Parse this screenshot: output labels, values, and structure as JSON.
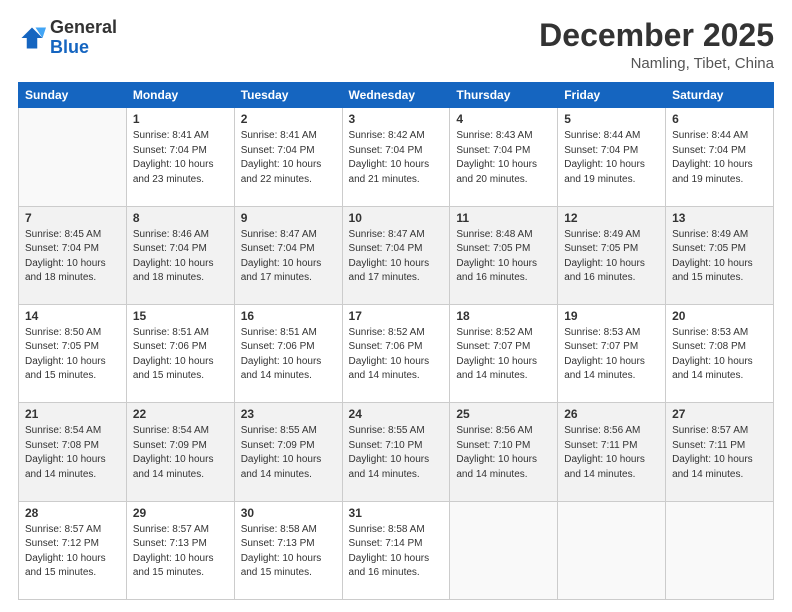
{
  "header": {
    "logo": {
      "general": "General",
      "blue": "Blue"
    },
    "title": "December 2025",
    "location": "Namling, Tibet, China"
  },
  "days_of_week": [
    "Sunday",
    "Monday",
    "Tuesday",
    "Wednesday",
    "Thursday",
    "Friday",
    "Saturday"
  ],
  "weeks": [
    [
      {
        "day": "",
        "empty": true
      },
      {
        "day": "1",
        "sunrise": "8:41 AM",
        "sunset": "7:04 PM",
        "daylight": "10 hours and 23 minutes."
      },
      {
        "day": "2",
        "sunrise": "8:41 AM",
        "sunset": "7:04 PM",
        "daylight": "10 hours and 22 minutes."
      },
      {
        "day": "3",
        "sunrise": "8:42 AM",
        "sunset": "7:04 PM",
        "daylight": "10 hours and 21 minutes."
      },
      {
        "day": "4",
        "sunrise": "8:43 AM",
        "sunset": "7:04 PM",
        "daylight": "10 hours and 20 minutes."
      },
      {
        "day": "5",
        "sunrise": "8:44 AM",
        "sunset": "7:04 PM",
        "daylight": "10 hours and 19 minutes."
      },
      {
        "day": "6",
        "sunrise": "8:44 AM",
        "sunset": "7:04 PM",
        "daylight": "10 hours and 19 minutes."
      }
    ],
    [
      {
        "day": "7",
        "sunrise": "8:45 AM",
        "sunset": "7:04 PM",
        "daylight": "10 hours and 18 minutes."
      },
      {
        "day": "8",
        "sunrise": "8:46 AM",
        "sunset": "7:04 PM",
        "daylight": "10 hours and 18 minutes."
      },
      {
        "day": "9",
        "sunrise": "8:47 AM",
        "sunset": "7:04 PM",
        "daylight": "10 hours and 17 minutes."
      },
      {
        "day": "10",
        "sunrise": "8:47 AM",
        "sunset": "7:04 PM",
        "daylight": "10 hours and 17 minutes."
      },
      {
        "day": "11",
        "sunrise": "8:48 AM",
        "sunset": "7:05 PM",
        "daylight": "10 hours and 16 minutes."
      },
      {
        "day": "12",
        "sunrise": "8:49 AM",
        "sunset": "7:05 PM",
        "daylight": "10 hours and 16 minutes."
      },
      {
        "day": "13",
        "sunrise": "8:49 AM",
        "sunset": "7:05 PM",
        "daylight": "10 hours and 15 minutes."
      }
    ],
    [
      {
        "day": "14",
        "sunrise": "8:50 AM",
        "sunset": "7:05 PM",
        "daylight": "10 hours and 15 minutes."
      },
      {
        "day": "15",
        "sunrise": "8:51 AM",
        "sunset": "7:06 PM",
        "daylight": "10 hours and 15 minutes."
      },
      {
        "day": "16",
        "sunrise": "8:51 AM",
        "sunset": "7:06 PM",
        "daylight": "10 hours and 14 minutes."
      },
      {
        "day": "17",
        "sunrise": "8:52 AM",
        "sunset": "7:06 PM",
        "daylight": "10 hours and 14 minutes."
      },
      {
        "day": "18",
        "sunrise": "8:52 AM",
        "sunset": "7:07 PM",
        "daylight": "10 hours and 14 minutes."
      },
      {
        "day": "19",
        "sunrise": "8:53 AM",
        "sunset": "7:07 PM",
        "daylight": "10 hours and 14 minutes."
      },
      {
        "day": "20",
        "sunrise": "8:53 AM",
        "sunset": "7:08 PM",
        "daylight": "10 hours and 14 minutes."
      }
    ],
    [
      {
        "day": "21",
        "sunrise": "8:54 AM",
        "sunset": "7:08 PM",
        "daylight": "10 hours and 14 minutes."
      },
      {
        "day": "22",
        "sunrise": "8:54 AM",
        "sunset": "7:09 PM",
        "daylight": "10 hours and 14 minutes."
      },
      {
        "day": "23",
        "sunrise": "8:55 AM",
        "sunset": "7:09 PM",
        "daylight": "10 hours and 14 minutes."
      },
      {
        "day": "24",
        "sunrise": "8:55 AM",
        "sunset": "7:10 PM",
        "daylight": "10 hours and 14 minutes."
      },
      {
        "day": "25",
        "sunrise": "8:56 AM",
        "sunset": "7:10 PM",
        "daylight": "10 hours and 14 minutes."
      },
      {
        "day": "26",
        "sunrise": "8:56 AM",
        "sunset": "7:11 PM",
        "daylight": "10 hours and 14 minutes."
      },
      {
        "day": "27",
        "sunrise": "8:57 AM",
        "sunset": "7:11 PM",
        "daylight": "10 hours and 14 minutes."
      }
    ],
    [
      {
        "day": "28",
        "sunrise": "8:57 AM",
        "sunset": "7:12 PM",
        "daylight": "10 hours and 15 minutes."
      },
      {
        "day": "29",
        "sunrise": "8:57 AM",
        "sunset": "7:13 PM",
        "daylight": "10 hours and 15 minutes."
      },
      {
        "day": "30",
        "sunrise": "8:58 AM",
        "sunset": "7:13 PM",
        "daylight": "10 hours and 15 minutes."
      },
      {
        "day": "31",
        "sunrise": "8:58 AM",
        "sunset": "7:14 PM",
        "daylight": "10 hours and 16 minutes."
      },
      {
        "day": "",
        "empty": true
      },
      {
        "day": "",
        "empty": true
      },
      {
        "day": "",
        "empty": true
      }
    ]
  ]
}
